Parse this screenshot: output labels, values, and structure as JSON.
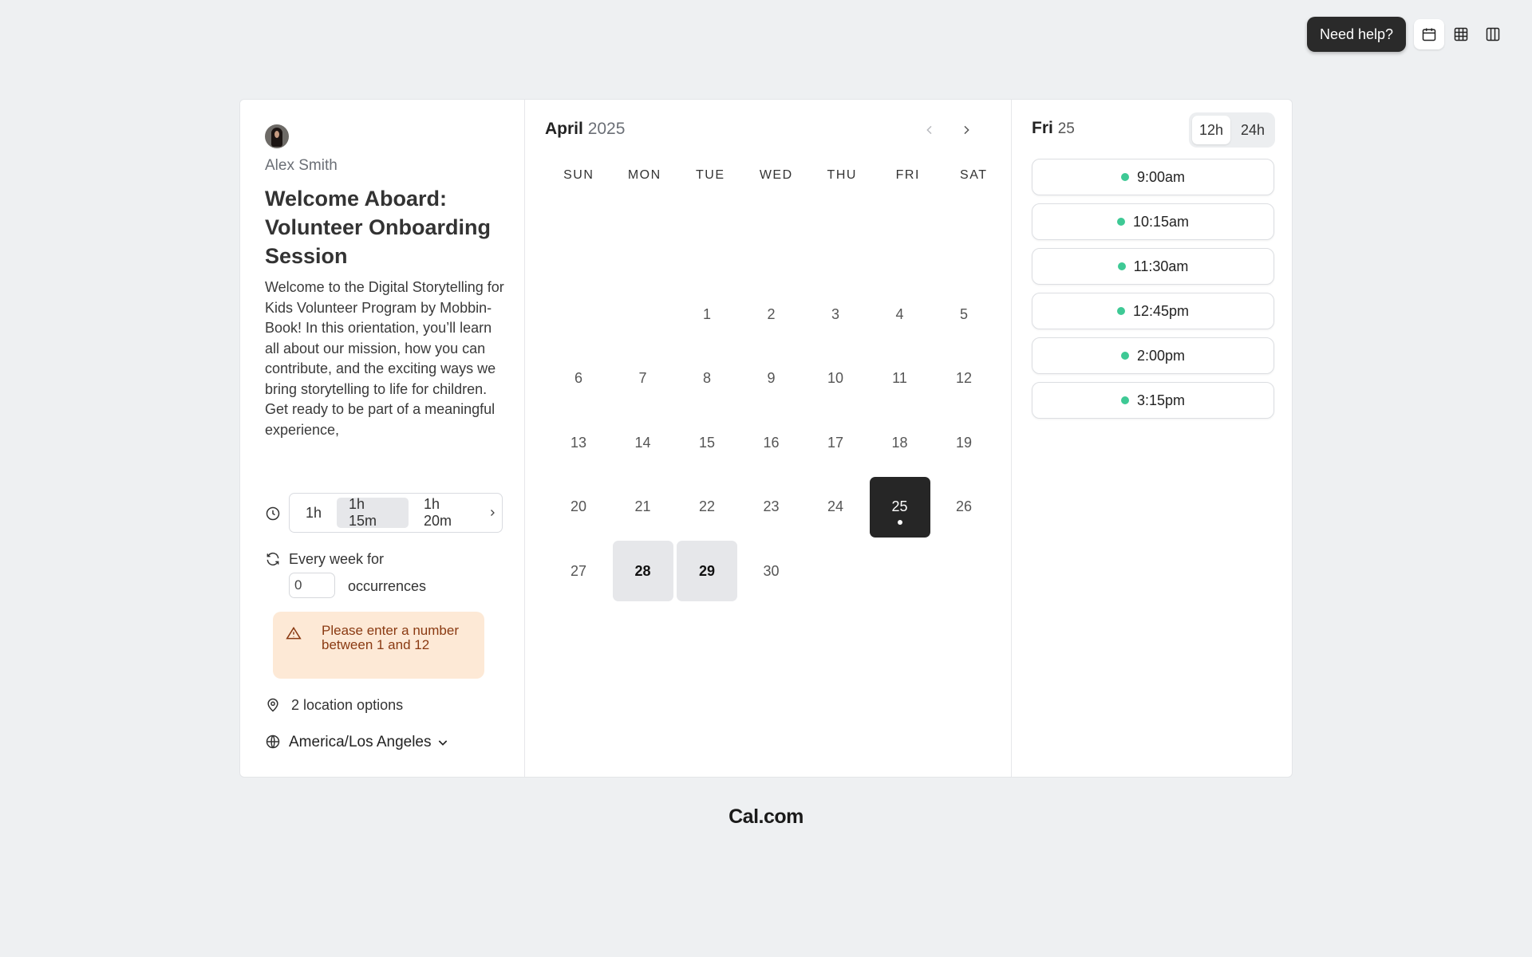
{
  "topbar": {
    "help_label": "Need help?",
    "views": [
      {
        "name": "month-view",
        "icon": "calendar-icon",
        "active": true
      },
      {
        "name": "weekly-view",
        "icon": "grid-icon",
        "active": false
      },
      {
        "name": "column-view",
        "icon": "columns-icon",
        "active": false
      }
    ]
  },
  "event": {
    "host_name": "Alex Smith",
    "title": "Welcome Aboard: Volunteer Onboarding Session",
    "description": "Welcome to the Digital Storytelling for Kids Volunteer Program by Mobbin-Book! In this orientation, you’ll learn all about our mission, how you can contribute, and the exciting ways we bring storytelling to life for children. Get ready to be part of a meaningful experience,",
    "durations": [
      "1h",
      "1h 15m",
      "1h 20m"
    ],
    "duration_selected": "1h 15m",
    "recurring_label": "Every week for",
    "occurrences_value": "0",
    "occurrences_label": "occurrences",
    "warning": "Please enter a number between 1 and 12",
    "location": "2 location options",
    "timezone": "America/Los Angeles"
  },
  "calendar": {
    "month": "April",
    "year": "2025",
    "weekdays": [
      "SUN",
      "MON",
      "TUE",
      "WED",
      "THU",
      "FRI",
      "SAT"
    ],
    "first_weekday_index": 2,
    "days_in_month": 30,
    "available_days": [
      25,
      28,
      29
    ],
    "selected_day": 25
  },
  "slots": {
    "day_name": "Fri",
    "day_number": "25",
    "formats": [
      "12h",
      "24h"
    ],
    "format_selected": "12h",
    "times": [
      "9:00am",
      "10:15am",
      "11:30am",
      "12:45pm",
      "2:00pm",
      "3:15pm"
    ],
    "status_color": "#3ec995"
  },
  "footer": {
    "brand": "Cal.com"
  }
}
